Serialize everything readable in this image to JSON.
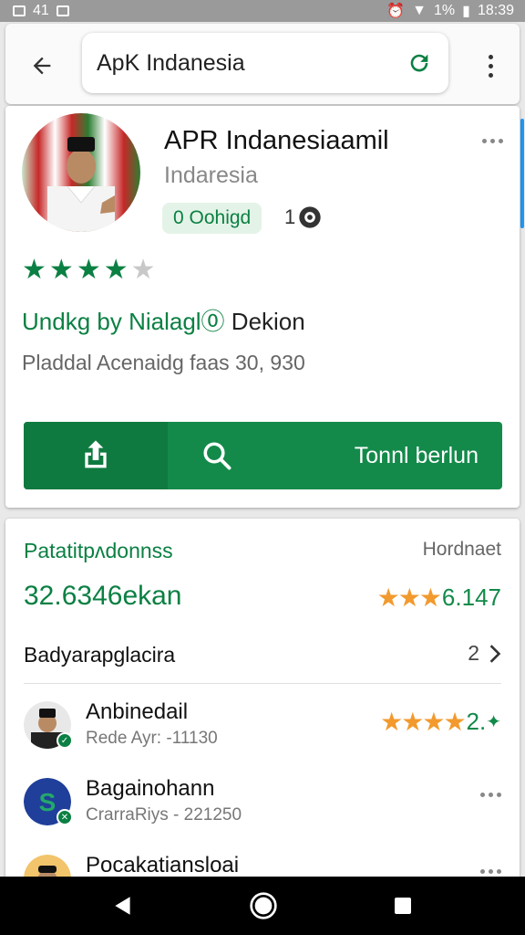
{
  "status_bar": {
    "left_text": "41",
    "battery": "1%",
    "time": "18:39"
  },
  "search": {
    "query": "ApK Indanesia"
  },
  "app": {
    "title": "APR Indanesiaamil",
    "subtitle": "Indaresia",
    "badge": "0 Oohigd",
    "count": "1",
    "rating_fraction": 0.9,
    "developer_green": "Undkg by Nialagl⓪",
    "developer_dark": " Dekion",
    "meta": "Pladdal Acenaidg faas 30, 930",
    "install_label": "Tonnl berlun"
  },
  "ratings": {
    "title": "Patatitpʌdonnss",
    "right_label": "Hordnaet",
    "total": "32.6346ekan",
    "score": "6.147",
    "reviews_heading": "Badyarapglacira",
    "reviews_count": "2"
  },
  "reviews": [
    {
      "name": "Anbinedail",
      "meta": "Rede Ayr: -11130",
      "score": "2.",
      "stars": 4
    },
    {
      "name": "Bagainohann",
      "meta": "CrarraRiys - 221250"
    },
    {
      "name": "Pocakatiansloai"
    }
  ],
  "colors": {
    "accent": "#0b8043",
    "install": "#138a4a",
    "star": "#f29a2e"
  },
  "icons": [
    "back-arrow-icon",
    "refresh-icon",
    "more-vert-icon",
    "share-icon",
    "search-icon",
    "chevron-right-icon",
    "verified-icon",
    "nav-back-icon",
    "nav-home-icon",
    "nav-recents-icon"
  ]
}
